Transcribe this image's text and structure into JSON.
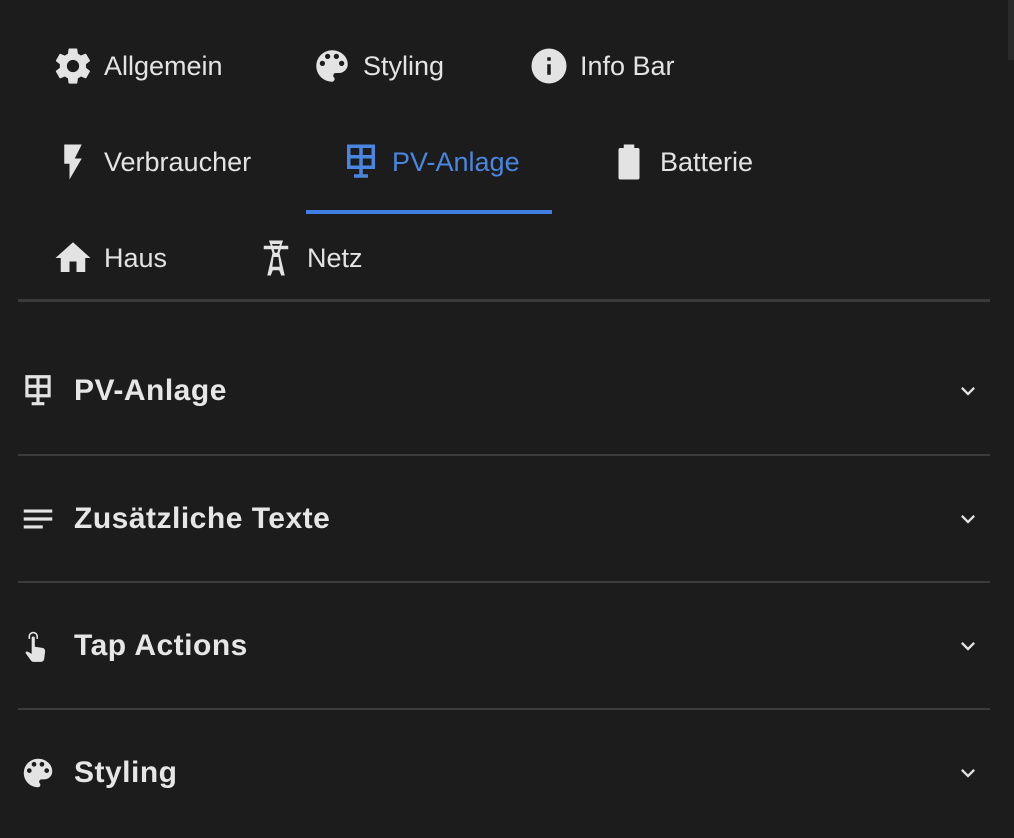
{
  "tabs": [
    {
      "label": "Allgemein",
      "icon": "gear-icon"
    },
    {
      "label": "Styling",
      "icon": "palette-icon"
    },
    {
      "label": "Info Bar",
      "icon": "info-icon"
    },
    {
      "label": "Verbraucher",
      "icon": "lightning-icon"
    },
    {
      "label": "PV-Anlage",
      "icon": "solar-panel-icon",
      "active": true
    },
    {
      "label": "Batterie",
      "icon": "battery-icon"
    },
    {
      "label": "Haus",
      "icon": "home-icon"
    },
    {
      "label": "Netz",
      "icon": "transmission-tower-icon"
    }
  ],
  "panels": [
    {
      "title": "PV-Anlage",
      "icon": "solar-panel-icon"
    },
    {
      "title": "Zusätzliche Texte",
      "icon": "text-lines-icon"
    },
    {
      "title": "Tap Actions",
      "icon": "gesture-tap-icon"
    },
    {
      "title": "Styling",
      "icon": "palette-icon"
    }
  ],
  "colors": {
    "background": "#1c1c1c",
    "text": "#e3e3e3",
    "accent": "#4a86e0",
    "divider": "#3c3c3c"
  }
}
